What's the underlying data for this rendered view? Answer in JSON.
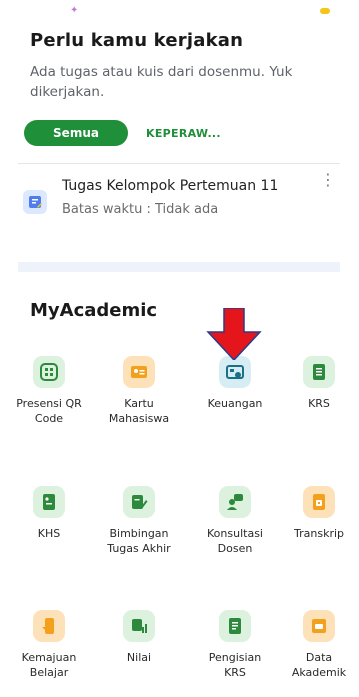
{
  "header": {
    "title": "Perlu kamu kerjakan",
    "description": "Ada tugas atau kuis dari dosenmu. Yuk dikerjakan."
  },
  "filters": {
    "active": "Semua",
    "other": "KEPERAW..."
  },
  "task": {
    "title": "Tugas Kelompok Pertemuan 11",
    "deadline": "Batas waktu : Tidak ada",
    "icon": "notebook-icon"
  },
  "myacademic": {
    "title": "MyAcademic",
    "items": [
      {
        "label_1": "Presensi QR",
        "label_2": "Code",
        "icon": "qr-scan-icon",
        "color": "#dcf1de"
      },
      {
        "label_1": "Kartu",
        "label_2": "Mahasiswa",
        "icon": "id-card-icon",
        "color": "#fde2b9"
      },
      {
        "label_1": "Keuangan",
        "label_2": "",
        "icon": "finance-icon",
        "color": "#d6eef3"
      },
      {
        "label_1": "KRS",
        "label_2": "",
        "icon": "document-list-icon",
        "color": "#dcf1de"
      },
      {
        "label_1": "KHS",
        "label_2": "",
        "icon": "report-card-icon",
        "color": "#dcf1de"
      },
      {
        "label_1": "Bimbingan",
        "label_2": "Tugas Akhir",
        "icon": "book-pen-icon",
        "color": "#dcf1de"
      },
      {
        "label_1": "Konsultasi",
        "label_2": "Dosen",
        "icon": "chat-user-icon",
        "color": "#dcf1de"
      },
      {
        "label_1": "Transkrip",
        "label_2": "",
        "icon": "transcript-icon",
        "color": "#fde2b9"
      },
      {
        "label_1": "Kemajuan",
        "label_2": "Belajar",
        "icon": "progress-phone-icon",
        "color": "#fde2b9"
      },
      {
        "label_1": "Nilai",
        "label_2": "",
        "icon": "grade-chart-icon",
        "color": "#dcf1de"
      },
      {
        "label_1": "Pengisian",
        "label_2": "KRS",
        "icon": "form-fill-icon",
        "color": "#dcf1de"
      },
      {
        "label_1": "Data",
        "label_2": "Akademik",
        "icon": "folder-data-icon",
        "color": "#fde2b9"
      }
    ]
  },
  "colors": {
    "accent_green": "#1f8f3a",
    "icon_green": "#2d8a3c",
    "icon_orange": "#f3a11c",
    "icon_teal": "#1b6f86",
    "annotation_red": "#e4161b"
  }
}
